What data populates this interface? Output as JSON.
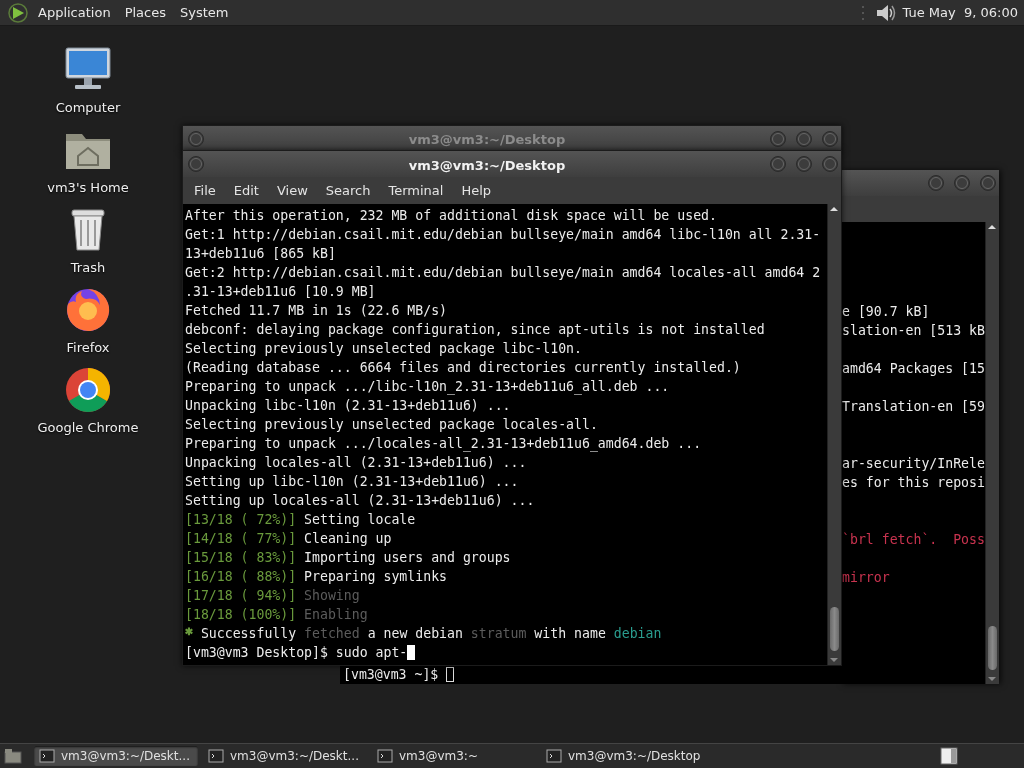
{
  "top_panel": {
    "menus": [
      "Application",
      "Places",
      "System"
    ],
    "clock": "Tue May  9, 06:00"
  },
  "desktop_icons": [
    {
      "label": "Computer",
      "kind": "computer"
    },
    {
      "label": "vm3's Home",
      "kind": "home"
    },
    {
      "label": "Trash",
      "kind": "trash"
    },
    {
      "label": "Firefox",
      "kind": "firefox"
    },
    {
      "label": "Google Chrome",
      "kind": "chrome"
    }
  ],
  "windows": [
    {
      "title": "vm3@vm3:~/Desktop",
      "focused": false
    },
    {
      "title": "vm3@vm3:~/Desktop",
      "focused": true,
      "menu": [
        "File",
        "Edit",
        "View",
        "Search",
        "Terminal",
        "Help"
      ],
      "lines": [
        {
          "text": "After this operation, 232 MB of additional disk space will be used.",
          "color": "#ececec"
        },
        {
          "text": "Get:1 http://debian.csail.mit.edu/debian bullseye/main amd64 libc-l10n all 2.31-",
          "color": "#ececec"
        },
        {
          "text": "13+deb11u6 [865 kB]",
          "color": "#ececec"
        },
        {
          "text": "Get:2 http://debian.csail.mit.edu/debian bullseye/main amd64 locales-all amd64 2",
          "color": "#ececec"
        },
        {
          "text": ".31-13+deb11u6 [10.9 MB]",
          "color": "#ececec"
        },
        {
          "text": "Fetched 11.7 MB in 1s (22.6 MB/s)",
          "color": "#ececec"
        },
        {
          "text": "debconf: delaying package configuration, since apt-utils is not installed",
          "color": "#ececec"
        },
        {
          "text": "Selecting previously unselected package libc-l10n.",
          "color": "#ececec"
        },
        {
          "text": "(Reading database ... 6664 files and directories currently installed.)",
          "color": "#ececec"
        },
        {
          "text": "Preparing to unpack .../libc-l10n_2.31-13+deb11u6_all.deb ...",
          "color": "#ececec"
        },
        {
          "text": "Unpacking libc-l10n (2.31-13+deb11u6) ...",
          "color": "#ececec"
        },
        {
          "text": "Selecting previously unselected package locales-all.",
          "color": "#ececec"
        },
        {
          "text": "Preparing to unpack .../locales-all_2.31-13+deb11u6_amd64.deb ...",
          "color": "#ececec"
        },
        {
          "text": "Unpacking locales-all (2.31-13+deb11u6) ...",
          "color": "#ececec"
        },
        {
          "text": "Setting up libc-l10n (2.31-13+deb11u6) ...",
          "color": "#ececec"
        },
        {
          "text": "Setting up locales-all (2.31-13+deb11u6) ...",
          "color": "#ececec"
        },
        {
          "segments": [
            {
              "text": "[13/18 ( 72%)]",
              "color": "#6a9a3c"
            },
            {
              "text": " Setting locale",
              "color": "#ececec"
            }
          ]
        },
        {
          "segments": [
            {
              "text": "[14/18 ( 77%)]",
              "color": "#6a9a3c"
            },
            {
              "text": " Cleaning up",
              "color": "#ececec"
            }
          ]
        },
        {
          "segments": [
            {
              "text": "[15/18 ( 83%)]",
              "color": "#6a9a3c"
            },
            {
              "text": " Importing users and groups",
              "color": "#ececec"
            }
          ]
        },
        {
          "segments": [
            {
              "text": "[16/18 ( 88%)]",
              "color": "#6a9a3c"
            },
            {
              "text": " Preparing symlinks",
              "color": "#ececec"
            }
          ]
        },
        {
          "segments": [
            {
              "text": "[17/18 ( 94%)]",
              "color": "#6a9a3c"
            },
            {
              "text": " Showing",
              "color": "#5c5c5c"
            }
          ]
        },
        {
          "segments": [
            {
              "text": "[18/18 (100%)]",
              "color": "#6a9a3c"
            },
            {
              "text": " Enabling",
              "color": "#5c5c5c"
            }
          ]
        },
        {
          "segments": [
            {
              "text": "*",
              "color": "#6a9a3c"
            },
            {
              "text": " Successfully ",
              "color": "#ececec"
            },
            {
              "text": "fetched",
              "color": "#5c5c5c"
            },
            {
              "text": " a new debian ",
              "color": "#ececec"
            },
            {
              "text": "stratum",
              "color": "#5c5c5c"
            },
            {
              "text": " with name ",
              "color": "#ececec"
            },
            {
              "text": "debian",
              "color": "#2a9d8f"
            }
          ]
        }
      ],
      "input_line": "[vm3@vm3 Desktop]$ sudo apt-"
    },
    {
      "focused": false,
      "lines": [
        {
          "text": "e [90.7 kB]",
          "color": "#ececec"
        },
        {
          "text": "slation-en [513 kB",
          "color": "#ececec"
        },
        {
          "text": "amd64 Packages [15",
          "color": "#ececec"
        },
        {
          "text": "Translation-en [59",
          "color": "#ececec"
        },
        {
          "text": "ar-security/InRele",
          "color": "#ececec"
        },
        {
          "text": "es for this reposi",
          "color": "#ececec"
        },
        {
          "text": "`brl fetch`.  Poss",
          "color": "#c9334f"
        },
        {
          "text": "mirror",
          "color": "#c9334f"
        }
      ],
      "input_line": "[vm3@vm3 ~]$ "
    }
  ],
  "taskbar": {
    "tasks": [
      {
        "label": "vm3@vm3:~/Deskt...",
        "selected": true
      },
      {
        "label": "vm3@vm3:~/Deskt...",
        "selected": false
      },
      {
        "label": "vm3@vm3:~",
        "selected": false
      },
      {
        "label": "vm3@vm3:~/Desktop",
        "selected": false
      }
    ]
  }
}
